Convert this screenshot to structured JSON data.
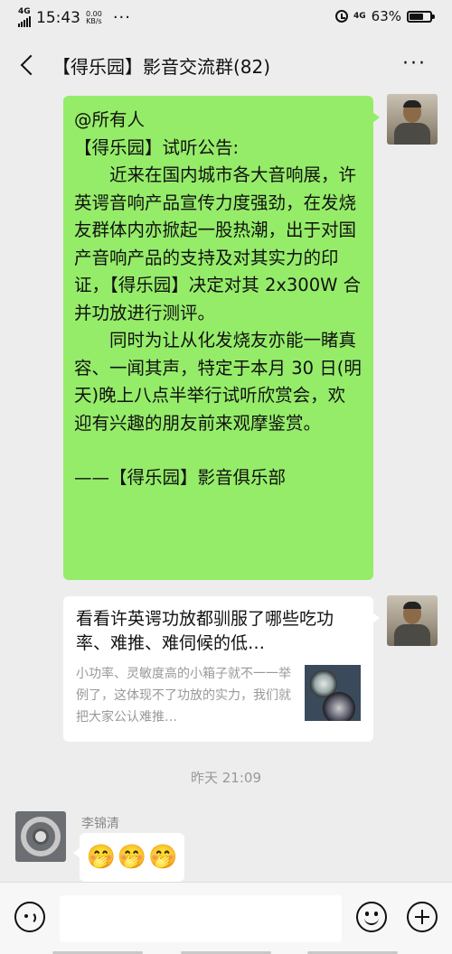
{
  "status_bar": {
    "network_left": "4G",
    "time": "15:43",
    "speed_value": "0.00",
    "speed_unit": "KB/s",
    "more_dots": "···",
    "network_right": "4G",
    "battery_percent": "63%",
    "battery_level": 0.63
  },
  "header": {
    "title": "【得乐园】影音交流群(82)",
    "more": "···"
  },
  "messages": {
    "announcement": {
      "line_at": "@所有人",
      "line_title": "【得乐园】试听公告:",
      "para1": "近来在国内城市各大音响展，许英谔音响产品宣传力度强劲，在发烧友群体内亦掀起一股热潮，出于对国产音响产品的支持及对其实力的印证，【得乐园】决定对其 2x300W 合并功放进行测评。",
      "para2": "同时为让从化发烧友亦能一睹真容、一闻其声，特定于本月 30 日(明天)晚上八点半举行试听欣赏会，欢迎有兴趣的朋友前来观摩鉴赏。",
      "signature": "——【得乐园】影音俱乐部"
    },
    "link_card": {
      "title": "看看许英谔功放都驯服了哪些吃功率、难推、难伺候的低…",
      "description": "小功率、灵敏度高的小箱子就不一一举例了，这体现不了功放的实力，我们就把大家公认难推…"
    },
    "timestamp": "昨天 21:09",
    "reply": {
      "sender": "李锦清",
      "emojis": [
        "🤭",
        "🤭",
        "🤭"
      ]
    }
  },
  "input_bar": {
    "placeholder": ""
  },
  "icons": {
    "back": "back-arrow-icon",
    "more": "more-icon",
    "voice": "voice-icon",
    "emoji": "emoji-icon",
    "plus": "plus-icon"
  },
  "colors": {
    "chat_background": "#ededed",
    "self_bubble": "#95ec69",
    "other_bubble": "#ffffff",
    "timestamp_text": "#999999"
  }
}
